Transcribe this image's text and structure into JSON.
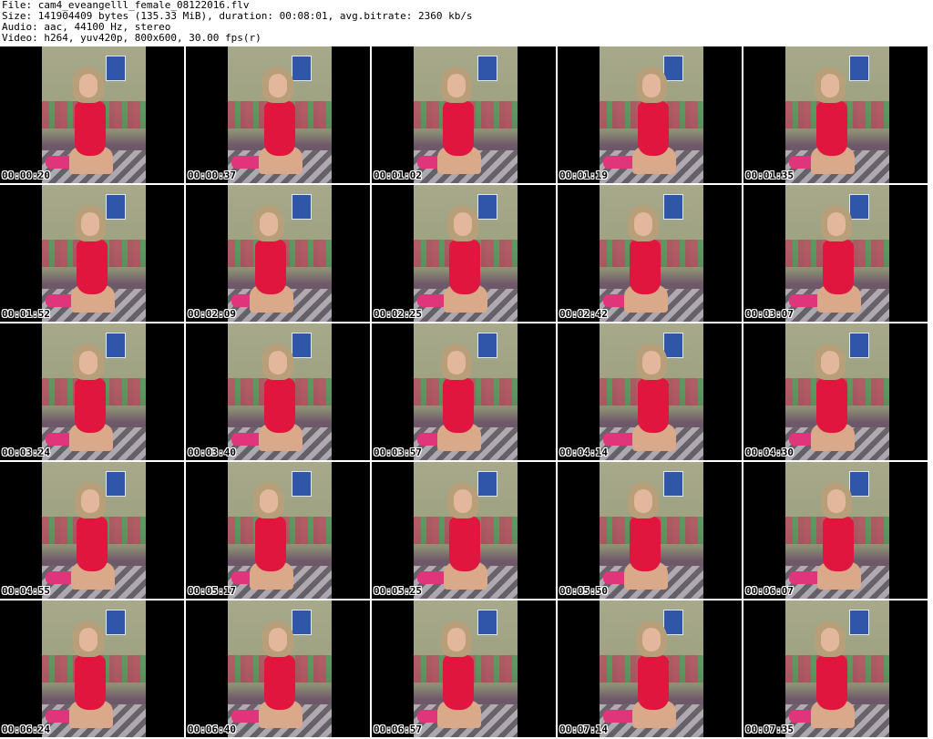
{
  "header": {
    "file": "File: cam4_eveangelll_female_08122016.flv",
    "size": "Size: 141904409 bytes (135.33 MiB), duration: 00:08:01, avg.bitrate: 2360 kb/s",
    "audio": "Audio: aac, 44100 Hz, stereo",
    "video": "Video: h264, yuv420p, 800x600, 30.00 fps(r)"
  },
  "thumbnails": [
    {
      "timestamp": "00:00:20"
    },
    {
      "timestamp": "00:00:37"
    },
    {
      "timestamp": "00:01:02"
    },
    {
      "timestamp": "00:01:19"
    },
    {
      "timestamp": "00:01:35"
    },
    {
      "timestamp": "00:01:52"
    },
    {
      "timestamp": "00:02:09"
    },
    {
      "timestamp": "00:02:25"
    },
    {
      "timestamp": "00:02:42"
    },
    {
      "timestamp": "00:03:07"
    },
    {
      "timestamp": "00:03:24"
    },
    {
      "timestamp": "00:03:40"
    },
    {
      "timestamp": "00:03:57"
    },
    {
      "timestamp": "00:04:14"
    },
    {
      "timestamp": "00:04:30"
    },
    {
      "timestamp": "00:04:55"
    },
    {
      "timestamp": "00:05:17"
    },
    {
      "timestamp": "00:05:25"
    },
    {
      "timestamp": "00:05:50"
    },
    {
      "timestamp": "00:06:07"
    },
    {
      "timestamp": "00:06:24"
    },
    {
      "timestamp": "00:06:40"
    },
    {
      "timestamp": "00:06:57"
    },
    {
      "timestamp": "00:07:14"
    },
    {
      "timestamp": "00:07:35"
    }
  ]
}
